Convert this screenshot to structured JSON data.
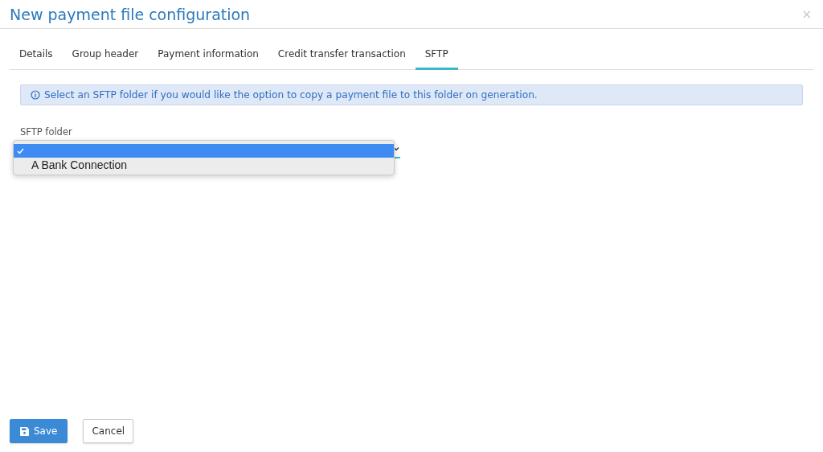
{
  "window": {
    "title": "New payment file configuration",
    "close": "×"
  },
  "tabs": [
    {
      "label": "Details",
      "selected": false
    },
    {
      "label": "Group header",
      "selected": false
    },
    {
      "label": "Payment information",
      "selected": false
    },
    {
      "label": "Credit transfer transaction",
      "selected": false
    },
    {
      "label": "SFTP",
      "selected": true
    }
  ],
  "alert": {
    "text": "Select an SFTP folder if you would like the option to copy a payment file to this folder on generation."
  },
  "sftp_folder": {
    "label": "SFTP folder",
    "expanded": true,
    "options": [
      {
        "selected": true
      },
      {
        "label": "A Bank Connection",
        "selected": false
      }
    ]
  },
  "buttons": [
    {
      "label": "Save",
      "kind": "primary"
    },
    {
      "label": "Cancel",
      "kind": "secondary"
    }
  ]
}
